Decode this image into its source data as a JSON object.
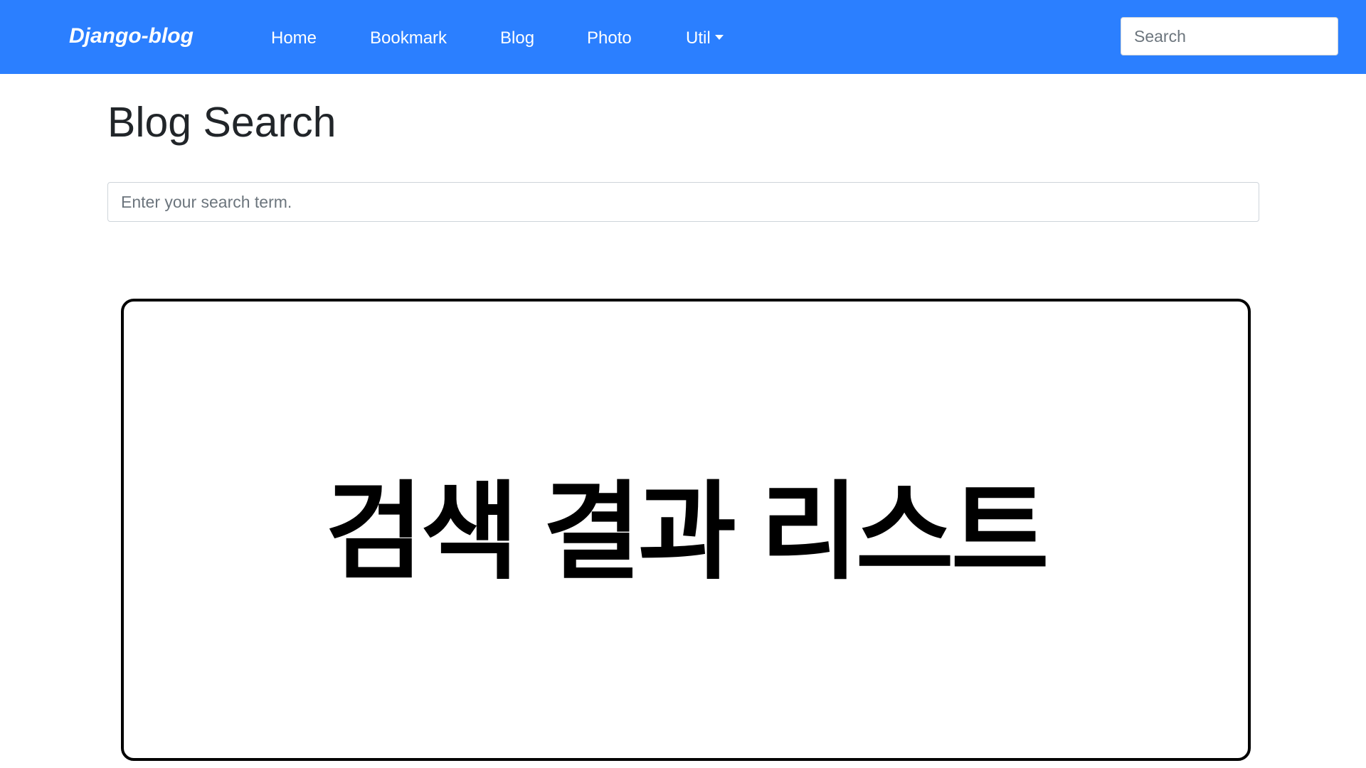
{
  "navbar": {
    "brand": "Django-blog",
    "items": [
      {
        "label": "Home"
      },
      {
        "label": "Bookmark"
      },
      {
        "label": "Blog"
      },
      {
        "label": "Photo"
      },
      {
        "label": "Util",
        "dropdown": true
      }
    ],
    "search_placeholder": "Search",
    "background_color": "#2b7fff"
  },
  "main": {
    "title": "Blog Search",
    "search_placeholder": "Enter your search term.",
    "results_placeholder": "검색 결과 리스트"
  }
}
